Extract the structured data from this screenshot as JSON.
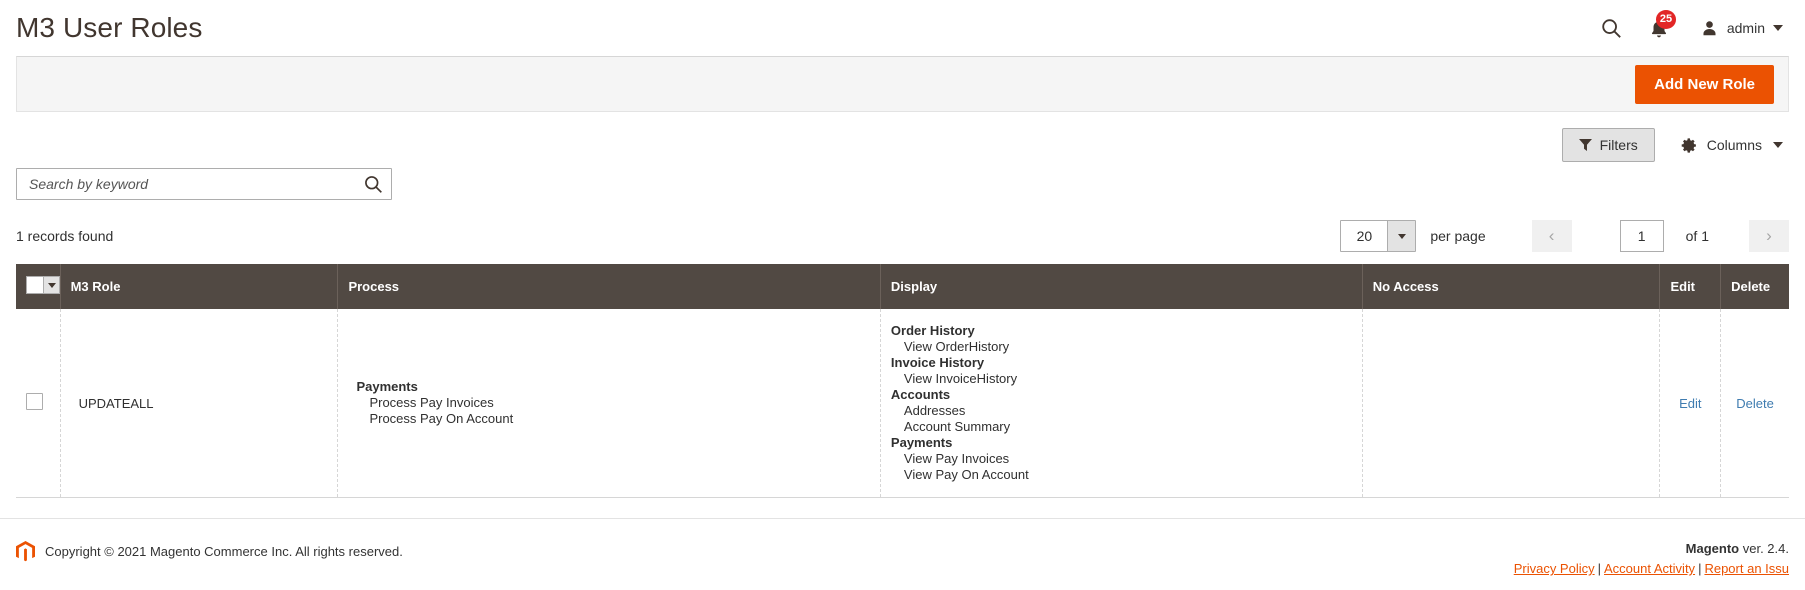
{
  "header": {
    "title": "M3 User Roles",
    "search_icon": "search-icon",
    "notifications_icon": "bell-icon",
    "notifications_count": "25",
    "user_icon": "user-avatar-icon",
    "user_name": "admin"
  },
  "page_actions": {
    "add_new_role_label": "Add New Role"
  },
  "toolbar": {
    "filters_label": "Filters",
    "filters_icon": "funnel-icon",
    "columns_label": "Columns",
    "columns_icon": "gear-icon"
  },
  "search": {
    "placeholder": "Search by keyword",
    "value": "",
    "submit_icon": "search-icon"
  },
  "grid_info": {
    "records_found": "1 records found",
    "per_page_value": "20",
    "per_page_label": "per page",
    "page_value": "1",
    "of_label": "of 1",
    "prev_icon": "chevron-left-icon",
    "next_icon": "chevron-right-icon"
  },
  "table": {
    "columns": {
      "select": "",
      "role": "M3 Role",
      "process": "Process",
      "display": "Display",
      "no_access": "No Access",
      "edit": "Edit",
      "delete": "Delete"
    },
    "rows": [
      {
        "role": "UPDATEALL",
        "process": [
          {
            "group": "Payments",
            "items": [
              "Process Pay Invoices",
              "Process Pay On Account"
            ]
          }
        ],
        "display": [
          {
            "group": "Order History",
            "items": [
              "View OrderHistory"
            ]
          },
          {
            "group": "Invoice History",
            "items": [
              "View InvoiceHistory"
            ]
          },
          {
            "group": "Accounts",
            "items": [
              "Addresses",
              "Account Summary"
            ]
          },
          {
            "group": "Payments",
            "items": [
              "View Pay Invoices",
              "View Pay On Account"
            ]
          }
        ],
        "no_access": [],
        "edit_label": "Edit",
        "delete_label": "Delete"
      }
    ]
  },
  "footer": {
    "copyright": "Copyright © 2021 Magento Commerce Inc. All rights reserved.",
    "logo_icon": "magento-logo-icon",
    "version_brand": "Magento",
    "version_text": " ver. 2.4.",
    "links": [
      {
        "label": "Privacy Policy"
      },
      {
        "label": "Account Activity"
      },
      {
        "label": "Report an Issu"
      }
    ],
    "separator": "|"
  },
  "colors": {
    "accent": "#eb5202",
    "header_row": "#514943",
    "link": "#3f7cb0",
    "badge": "#e22626"
  }
}
